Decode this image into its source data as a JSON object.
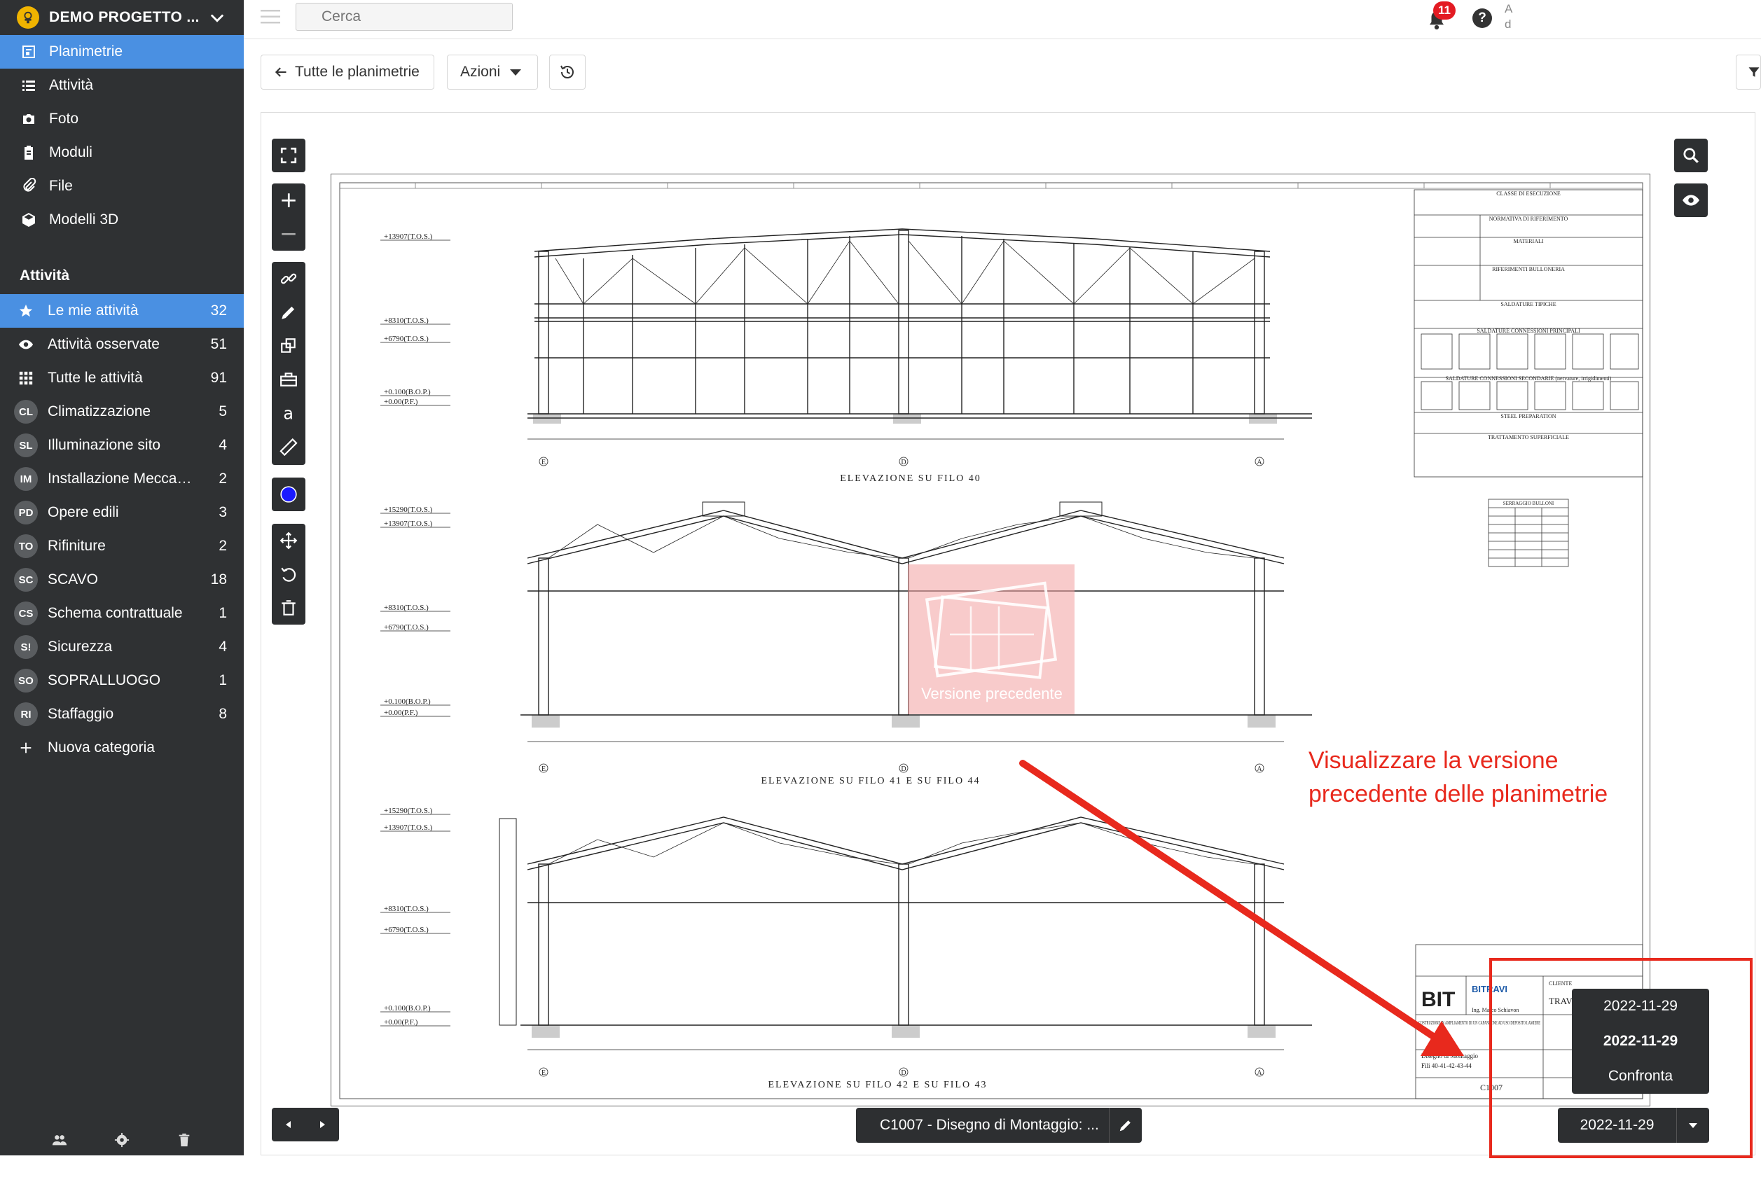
{
  "project": {
    "name": "DEMO PROGETTO ..."
  },
  "nav": [
    {
      "label": "Planimetrie",
      "icon": "floorplan-icon",
      "active": true
    },
    {
      "label": "Attività",
      "icon": "list-icon",
      "active": false
    },
    {
      "label": "Foto",
      "icon": "camera-icon",
      "active": false
    },
    {
      "label": "Moduli",
      "icon": "clipboard-icon",
      "active": false
    },
    {
      "label": "File",
      "icon": "paperclip-icon",
      "active": false
    },
    {
      "label": "Modelli 3D",
      "icon": "cube-icon",
      "active": false
    }
  ],
  "activities": {
    "title": "Attività",
    "items": [
      {
        "badge": "",
        "icon": "star-icon",
        "label": "Le mie attività",
        "count": "32",
        "active": true
      },
      {
        "badge": "",
        "icon": "eye-icon",
        "label": "Attività osservate",
        "count": "51",
        "active": false
      },
      {
        "badge": "",
        "icon": "grid-icon",
        "label": "Tutte le attività",
        "count": "91",
        "active": false
      },
      {
        "badge": "CL",
        "label": "Climatizzazione",
        "count": "5"
      },
      {
        "badge": "SL",
        "label": "Illuminazione sito",
        "count": "4"
      },
      {
        "badge": "IM",
        "label": "Installazione Meccani...",
        "count": "2"
      },
      {
        "badge": "PD",
        "label": "Opere edili",
        "count": "3"
      },
      {
        "badge": "TO",
        "label": "Rifiniture",
        "count": "2"
      },
      {
        "badge": "SC",
        "label": "SCAVO",
        "count": "18"
      },
      {
        "badge": "CS",
        "label": "Schema contrattuale",
        "count": "1"
      },
      {
        "badge": "S!",
        "label": "Sicurezza",
        "count": "4"
      },
      {
        "badge": "SO",
        "label": "SOPRALLUOGO",
        "count": "1"
      },
      {
        "badge": "RI",
        "label": "Staffaggio",
        "count": "8"
      }
    ],
    "new_category": "Nuova categoria"
  },
  "topbar": {
    "search_placeholder": "Cerca",
    "notifications_count": "11",
    "help_label": "?",
    "user_fragment": "A\nd"
  },
  "toolbar": {
    "back_label": "Tutte le planimetrie",
    "actions_label": "Azioni"
  },
  "viewer": {
    "watermark_label": "Versione precedente",
    "annotation": "Visualizzare la versione precedente delle planimetrie",
    "document_title": "C1007 - Disegno di Montaggio: ...",
    "selected_version": "2022-11-29",
    "version_menu": [
      {
        "label": "2022-11-29",
        "bold": false
      },
      {
        "label": "2022-11-29",
        "bold": true
      },
      {
        "label": "Confronta",
        "bold": false
      }
    ]
  },
  "drawing": {
    "elevations": [
      "ELEVAZIONE SU FILO 40",
      "ELEVAZIONE SU FILO 41 E SU FILO 44",
      "ELEVAZIONE SU FILO 42 E SU FILO 43"
    ],
    "levels_1": [
      "+13907(T.O.S.)",
      "+8310(T.O.S.)",
      "+6790(T.O.S.)",
      "+0.100(B.O.P.)",
      "+0.00(P.F.)"
    ],
    "levels_2": [
      "+15290(T.O.S.)",
      "+13907(T.O.S.)",
      "+8310(T.O.S.)",
      "+6790(T.O.S.)",
      "+0.100(B.O.P.)",
      "+0.00(P.F.)"
    ],
    "levels_3": [
      "+15290(T.O.S.)",
      "+13907(T.O.S.)",
      "+8310(T.O.S.)",
      "+6790(T.O.S.)",
      "+0.100(B.O.P.)",
      "+0.00(P.F.)"
    ],
    "axes": [
      "E",
      "D",
      "A"
    ],
    "spec_headers": [
      "CLASSE DI ESECUZIONE",
      "NORMATIVA DI RIFERIMENTO",
      "MATERIALI",
      "RIFERIMENTI BULLONERIA",
      "SALDATURE TIPICHE",
      "SALDATURE CONNESSIONI PRINCIPALI",
      "SALDATURE CONNESSIONI SECONDARIE (nervature, irrigidimenti)",
      "STEEL PREPARATION",
      "TRATTAMENTO SUPERFICIALE"
    ],
    "bolt_table_title": "SERRAGGIO BULLONI",
    "titleblock": {
      "logo_left": "BIT",
      "logo_right": "BITRAVI",
      "client_label": "CLIENTE",
      "project_name": "TRAVETTA",
      "engineer": "Ing. Marco Schiavon",
      "description": "COSTRUZIONE IN AMPLIAMENTO DI UN CAPANNONE AD USO DEPOSITO LAMIERE",
      "drawing_title": "Disegno di Montaggio",
      "drawing_subtitle": "Fili 40-41-42-43-44",
      "code": "C1007"
    }
  }
}
